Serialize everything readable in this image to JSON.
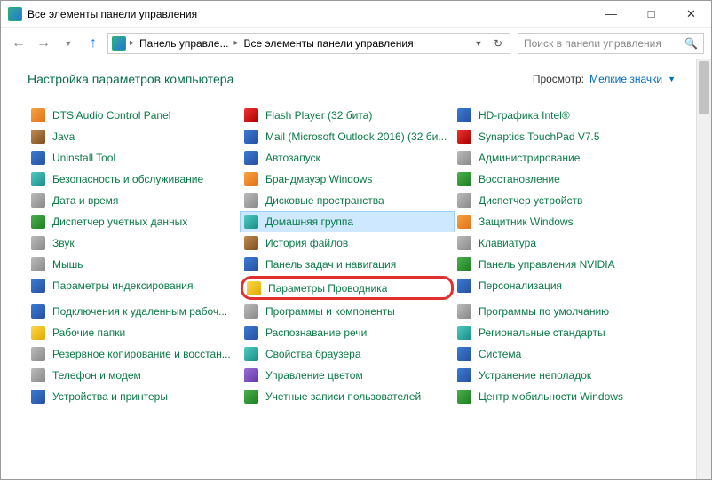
{
  "window": {
    "title": "Все элементы панели управления"
  },
  "breadcrumb": {
    "seg1": "Панель управле...",
    "seg2": "Все элементы панели управления"
  },
  "search": {
    "placeholder": "Поиск в панели управления"
  },
  "header": {
    "heading": "Настройка параметров компьютера",
    "viewLabel": "Просмотр:",
    "viewValue": "Мелкие значки"
  },
  "columns": [
    [
      {
        "label": "DTS Audio Control Panel",
        "icon": "c-orange"
      },
      {
        "label": "Java",
        "icon": "c-brown"
      },
      {
        "label": "Uninstall Tool",
        "icon": "c-blueink"
      },
      {
        "label": "Безопасность и обслуживание",
        "icon": "c-teal"
      },
      {
        "label": "Дата и время",
        "icon": "c-gray"
      },
      {
        "label": "Диспетчер учетных данных",
        "icon": "c-green"
      },
      {
        "label": "Звук",
        "icon": "c-gray"
      },
      {
        "label": "Мышь",
        "icon": "c-gray"
      },
      {
        "label": "Параметры индексирования",
        "icon": "c-blueink"
      },
      {
        "label": "Подключения к удаленным рабоч...",
        "icon": "c-blueink"
      },
      {
        "label": "Рабочие папки",
        "icon": "c-yellow"
      },
      {
        "label": "Резервное копирование и восстан...",
        "icon": "c-gray"
      },
      {
        "label": "Телефон и модем",
        "icon": "c-gray"
      },
      {
        "label": "Устройства и принтеры",
        "icon": "c-blueink"
      }
    ],
    [
      {
        "label": "Flash Player (32 бита)",
        "icon": "c-red"
      },
      {
        "label": "Mail (Microsoft Outlook 2016) (32 би...",
        "icon": "c-blueink"
      },
      {
        "label": "Автозапуск",
        "icon": "c-blueink"
      },
      {
        "label": "Брандмауэр Windows",
        "icon": "c-orange"
      },
      {
        "label": "Дисковые пространства",
        "icon": "c-gray"
      },
      {
        "label": "Домашняя группа",
        "icon": "c-teal",
        "selected": true
      },
      {
        "label": "История файлов",
        "icon": "c-brown"
      },
      {
        "label": "Панель задач и навигация",
        "icon": "c-blueink"
      },
      {
        "label": "Параметры Проводника",
        "icon": "c-yellow",
        "highlighted": true
      },
      {
        "label": "Программы и компоненты",
        "icon": "c-gray"
      },
      {
        "label": "Распознавание речи",
        "icon": "c-blueink"
      },
      {
        "label": "Свойства браузера",
        "icon": "c-teal"
      },
      {
        "label": "Управление цветом",
        "icon": "c-purple"
      },
      {
        "label": "Учетные записи пользователей",
        "icon": "c-green"
      }
    ],
    [
      {
        "label": "HD-графика Intel®",
        "icon": "c-blueink"
      },
      {
        "label": "Synaptics TouchPad V7.5",
        "icon": "c-red"
      },
      {
        "label": "Администрирование",
        "icon": "c-gray"
      },
      {
        "label": "Восстановление",
        "icon": "c-green"
      },
      {
        "label": "Диспетчер устройств",
        "icon": "c-gray"
      },
      {
        "label": "Защитник Windows",
        "icon": "c-orange"
      },
      {
        "label": "Клавиатура",
        "icon": "c-gray"
      },
      {
        "label": "Панель управления NVIDIA",
        "icon": "c-green"
      },
      {
        "label": "Персонализация",
        "icon": "c-blueink"
      },
      {
        "label": "Программы по умолчанию",
        "icon": "c-gray"
      },
      {
        "label": "Региональные стандарты",
        "icon": "c-teal"
      },
      {
        "label": "Система",
        "icon": "c-blueink"
      },
      {
        "label": "Устранение неполадок",
        "icon": "c-blueink"
      },
      {
        "label": "Центр мобильности Windows",
        "icon": "c-green"
      }
    ]
  ]
}
